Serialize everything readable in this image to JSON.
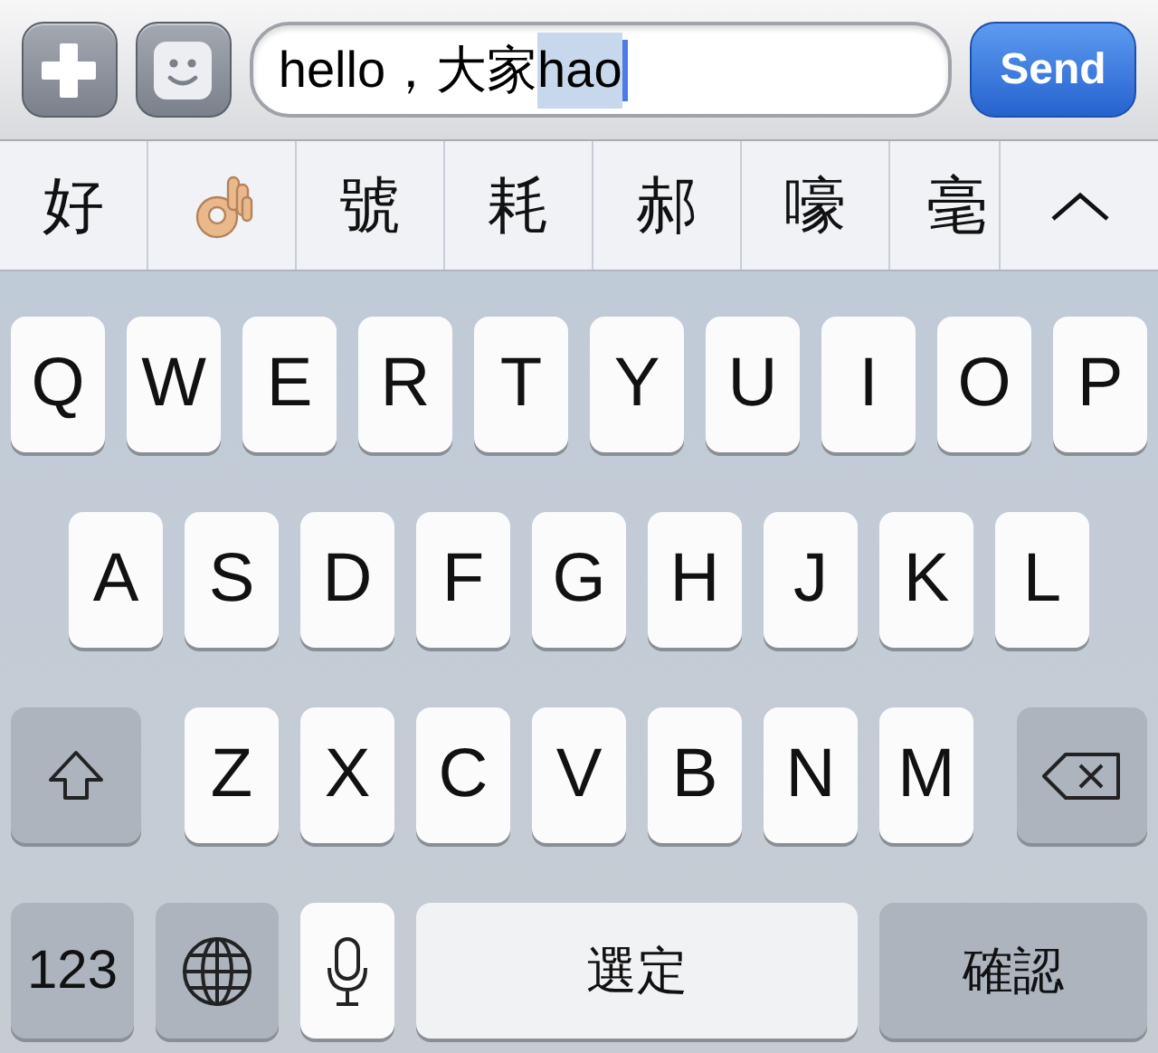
{
  "toolbar": {
    "buttons": [
      {
        "kind": "plus"
      },
      {
        "kind": "emoji"
      }
    ],
    "message": {
      "value": "hello，大家",
      "composing": "hao"
    },
    "send": "Send"
  },
  "candidates": [
    {
      "kind": "text",
      "text": "好"
    },
    {
      "kind": "emoji"
    },
    {
      "kind": "text",
      "text": "號"
    },
    {
      "kind": "text",
      "text": "耗"
    },
    {
      "kind": "text",
      "text": "郝"
    },
    {
      "kind": "text",
      "text": "嚎"
    },
    {
      "kind": "text",
      "text": "毫"
    },
    {
      "kind": "expand"
    }
  ],
  "keyboard": {
    "rows": [
      {
        "keys": [
          {
            "kind": "letter",
            "label": "Q"
          },
          {
            "kind": "letter",
            "label": "W"
          },
          {
            "kind": "letter",
            "label": "E"
          },
          {
            "kind": "letter",
            "label": "R"
          },
          {
            "kind": "letter",
            "label": "T"
          },
          {
            "kind": "letter",
            "label": "Y"
          },
          {
            "kind": "letter",
            "label": "U"
          },
          {
            "kind": "letter",
            "label": "I"
          },
          {
            "kind": "letter",
            "label": "O"
          },
          {
            "kind": "letter",
            "label": "P"
          }
        ]
      },
      {
        "keys": [
          {
            "kind": "letter",
            "label": "A"
          },
          {
            "kind": "letter",
            "label": "S"
          },
          {
            "kind": "letter",
            "label": "D"
          },
          {
            "kind": "letter",
            "label": "F"
          },
          {
            "kind": "letter",
            "label": "G"
          },
          {
            "kind": "letter",
            "label": "H"
          },
          {
            "kind": "letter",
            "label": "J"
          },
          {
            "kind": "letter",
            "label": "K"
          },
          {
            "kind": "letter",
            "label": "L"
          }
        ]
      },
      {
        "keys": [
          {
            "kind": "shift"
          },
          {
            "kind": "letter",
            "label": "Z"
          },
          {
            "kind": "letter",
            "label": "X"
          },
          {
            "kind": "letter",
            "label": "C"
          },
          {
            "kind": "letter",
            "label": "V"
          },
          {
            "kind": "letter",
            "label": "B"
          },
          {
            "kind": "letter",
            "label": "N"
          },
          {
            "kind": "letter",
            "label": "M"
          },
          {
            "kind": "backspace"
          }
        ]
      }
    ],
    "function_bar": {
      "keys": [
        {
          "kind": "mode",
          "label": "123"
        },
        {
          "kind": "globe"
        },
        {
          "kind": "mic"
        },
        {
          "kind": "space",
          "label": "選定"
        },
        {
          "kind": "return",
          "label": "確認"
        }
      ]
    }
  }
}
